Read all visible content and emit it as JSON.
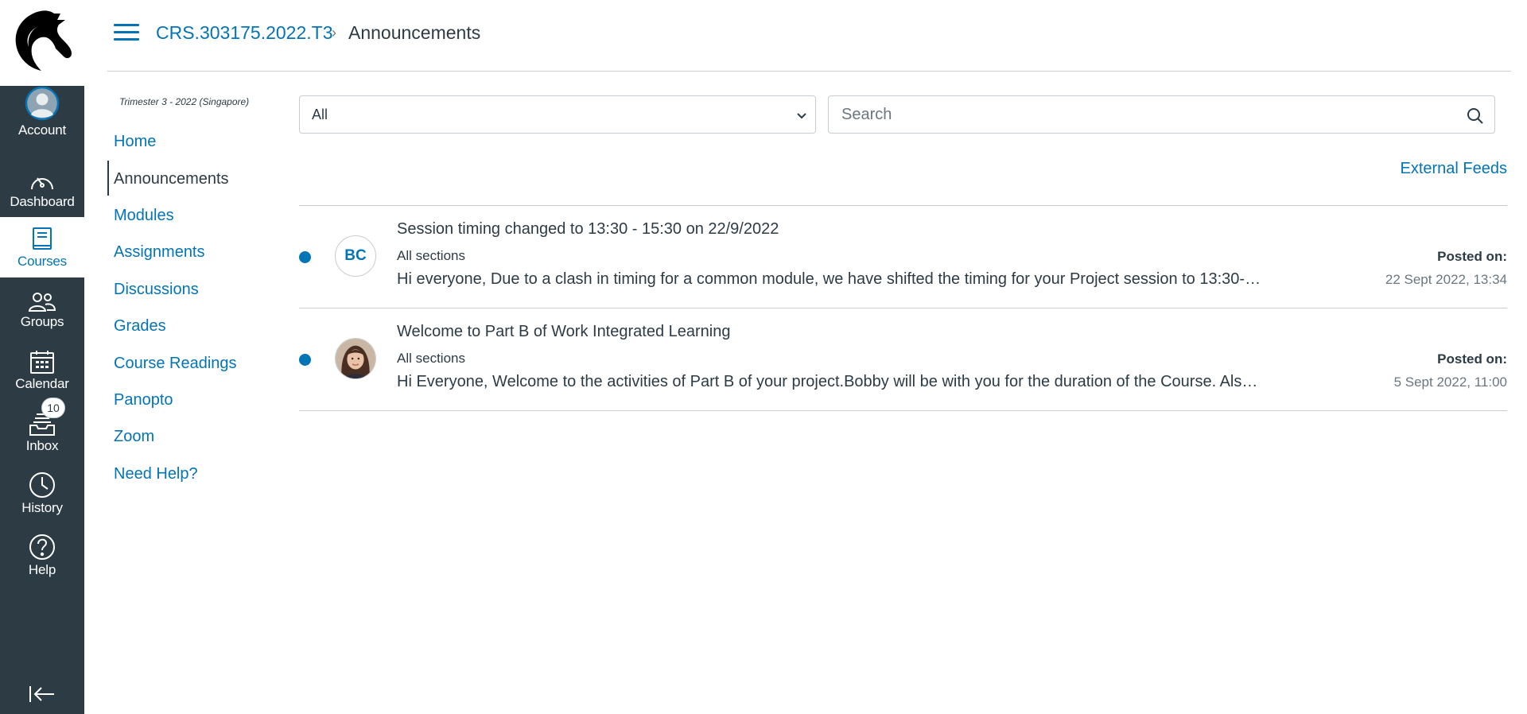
{
  "global_nav": {
    "items": [
      {
        "label": "Account",
        "icon": "avatar-icon"
      },
      {
        "label": "Dashboard",
        "icon": "speedometer-icon"
      },
      {
        "label": "Courses",
        "icon": "book-icon"
      },
      {
        "label": "Groups",
        "icon": "people-icon"
      },
      {
        "label": "Calendar",
        "icon": "calendar-icon"
      },
      {
        "label": "Inbox",
        "icon": "inbox-icon",
        "badge": "10"
      },
      {
        "label": "History",
        "icon": "clock-icon"
      },
      {
        "label": "Help",
        "icon": "question-icon"
      }
    ]
  },
  "header": {
    "course_crumb": "CRS.303175.2022.T3",
    "separator": "›",
    "current_page": "Announcements"
  },
  "course_nav": {
    "term": "Trimester 3 - 2022 (Singapore)",
    "links": [
      "Home",
      "Announcements",
      "Modules",
      "Assignments",
      "Discussions",
      "Grades",
      "Course Readings",
      "Panopto",
      "Zoom",
      "Need Help?"
    ]
  },
  "filters": {
    "select_value": "All",
    "search_placeholder": "Search"
  },
  "external_feeds": "External Feeds",
  "announcements": [
    {
      "avatar_initials": "BC",
      "title": "Session timing changed to 13:30 - 15:30 on 22/9/2022",
      "sections": "All sections",
      "snippet": "Hi everyone, Due to a clash in timing for a common module, we have shifted the timing for your Project session to 13:30-…",
      "posted_label": "Posted on:",
      "posted_date": "22 Sept 2022, 13:34"
    },
    {
      "avatar_initials": "",
      "title": "Welcome to Part B of Work Integrated Learning",
      "sections": "All sections",
      "snippet": "Hi Everyone, Welcome to the activities of Part B of your project.Bobby will be with you for the duration of the Course. Als…",
      "posted_label": "Posted on:",
      "posted_date": "5 Sept 2022, 11:00"
    }
  ],
  "colors": {
    "nav_bg": "#2d3b45",
    "accent": "#0374b5",
    "border": "#c7cdd1"
  }
}
